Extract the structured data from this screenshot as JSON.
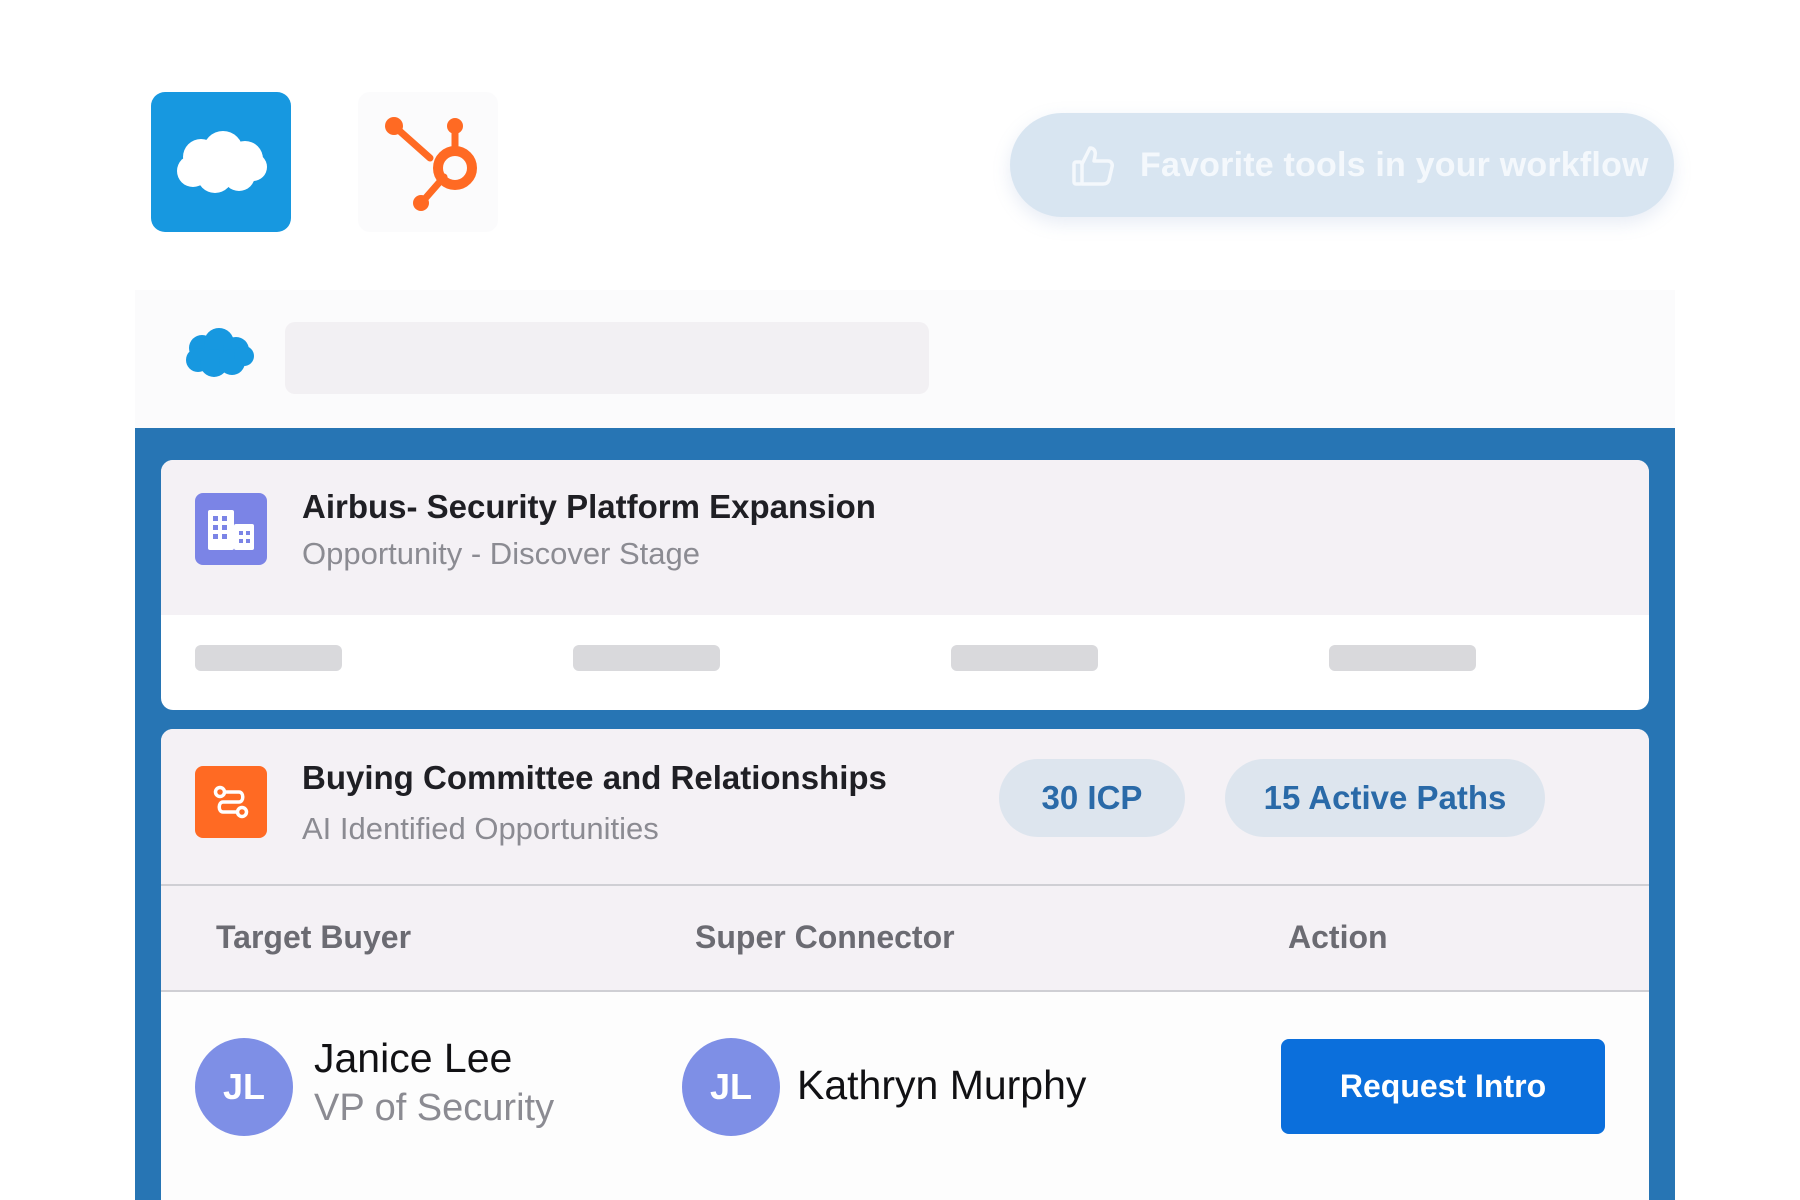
{
  "icons": {
    "salesforce": "salesforce-logo-icon",
    "hubspot": "hubspot-logo-icon",
    "favorite": "thumbs-up-icon",
    "opportunity": "building-icon",
    "committee": "route-icon"
  },
  "colors": {
    "salesforce_blue": "#1798e0",
    "hubspot_orange": "#ff6a23",
    "panel_blue": "#2775b4",
    "primary_button": "#0b6fdc",
    "avatar": "#7e8fe6",
    "chip_text": "#2a6aa8",
    "opportunity_icon_bg": "#7b84e6"
  },
  "header": {
    "favorite_label": "Favorite tools in your workflow"
  },
  "opportunity": {
    "title": "Airbus- Security Platform Expansion",
    "subtitle": "Opportunity - Discover Stage"
  },
  "committee": {
    "title": "Buying Committee and Relationships",
    "subtitle": "AI Identified Opportunities",
    "chips": [
      "30 ICP",
      "15 Active Paths"
    ],
    "columns": [
      "Target Buyer",
      "Super Connector",
      "Action"
    ],
    "rows": [
      {
        "buyer_initials": "JL",
        "buyer_name": "Janice Lee",
        "buyer_role": "VP of Security",
        "connector_initials": "JL",
        "connector_name": "Kathryn Murphy",
        "action_label": "Request Intro"
      }
    ]
  }
}
